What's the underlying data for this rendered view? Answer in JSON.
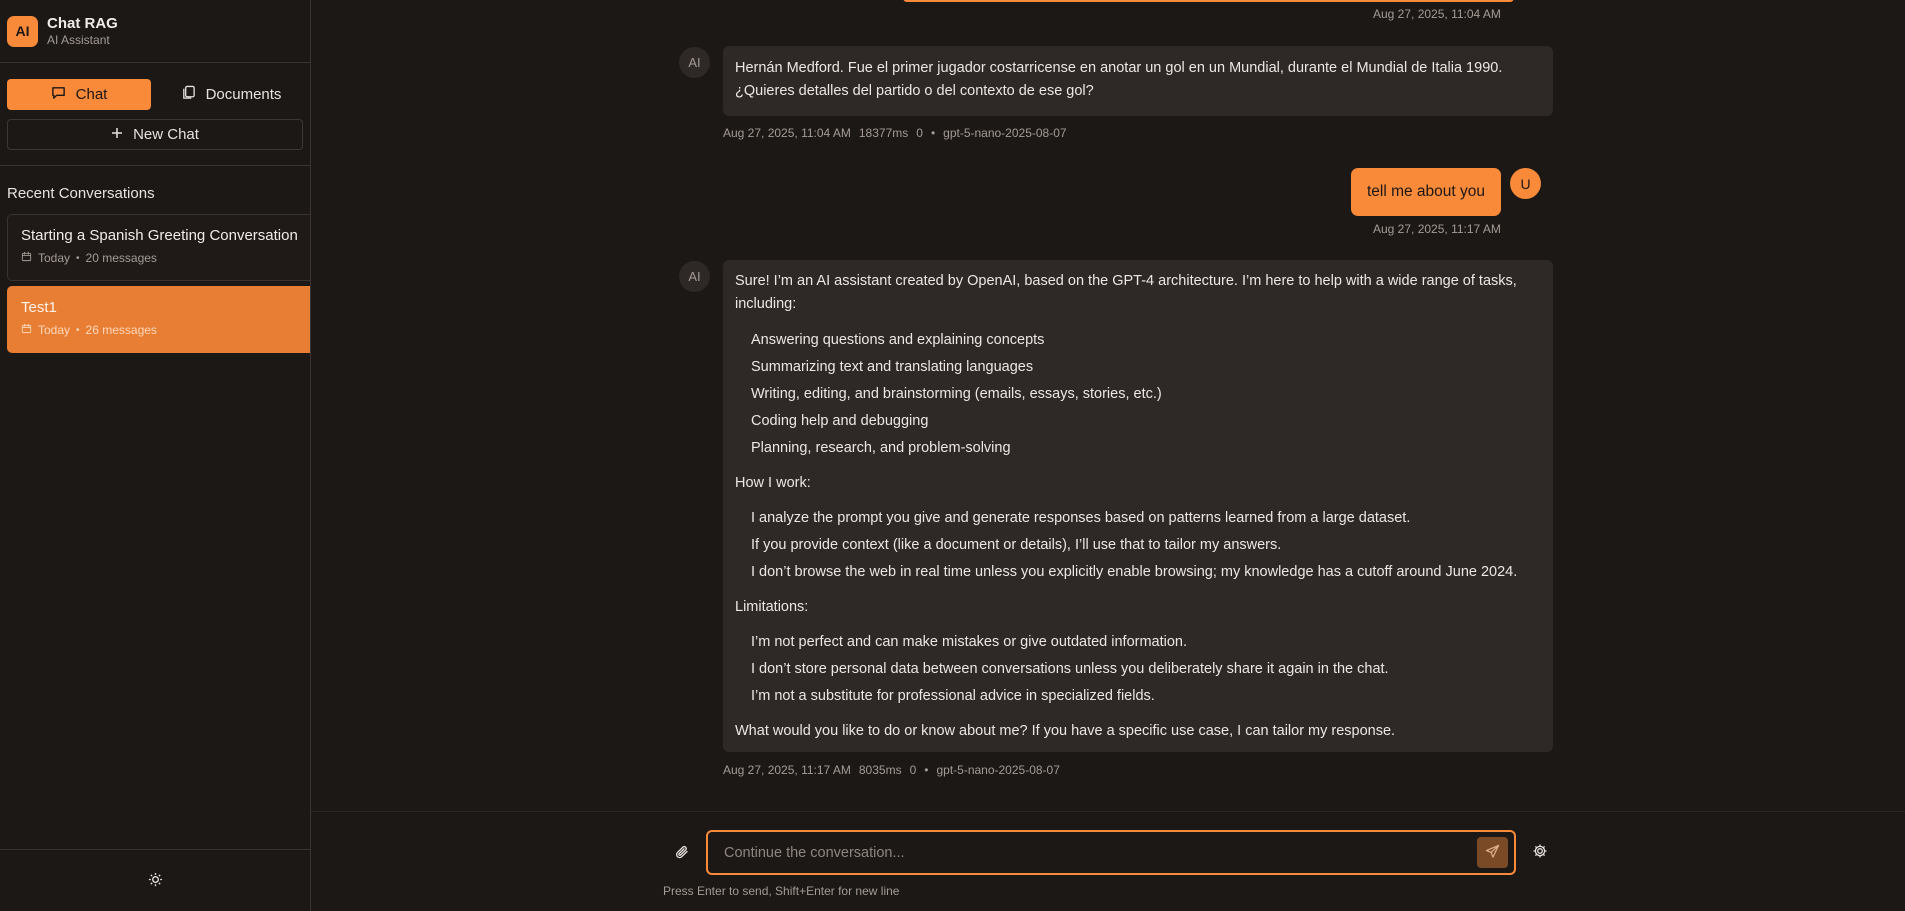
{
  "app": {
    "logo_text": "AI",
    "title": "Chat RAG",
    "subtitle": "AI Assistant"
  },
  "nav": {
    "chat_label": "Chat",
    "documents_label": "Documents",
    "new_chat_label": "New Chat"
  },
  "sidebar": {
    "recent_title": "Recent Conversations",
    "conversations": [
      {
        "title": "Starting a Spanish Greeting Conversation",
        "date": "Today",
        "count": "20 messages"
      },
      {
        "title": "Test1",
        "date": "Today",
        "count": "26 messages"
      }
    ]
  },
  "messages": {
    "top_time": "Aug 27, 2025, 11:04 AM",
    "ai1": {
      "avatar": "AI",
      "lines": [
        "Hernán Medford. Fue el primer jugador costarricense en anotar un gol en un Mundial, durante el Mundial de Italia 1990.",
        "¿Quieres detalles del partido o del contexto de ese gol?"
      ],
      "time": "Aug 27, 2025, 11:04 AM",
      "duration": "18377ms",
      "tokens": "0",
      "model": "gpt-5-nano-2025-08-07"
    },
    "user1": {
      "avatar": "U",
      "text": "tell me about you",
      "time": "Aug 27, 2025, 11:17 AM"
    },
    "ai2": {
      "avatar": "AI",
      "intro_1": "Sure! I’m an AI assistant created by OpenAI, based on the GPT-4 architecture. I’m here to help with a wide range of tasks,",
      "intro_2": "including:",
      "tasks": [
        "Answering questions and explaining concepts",
        "Summarizing text and translating languages",
        "Writing, editing, and brainstorming (emails, essays, stories, etc.)",
        "Coding help and debugging",
        "Planning, research, and problem-solving"
      ],
      "how_title": "How I work:",
      "how": [
        "I analyze the prompt you give and generate responses based on patterns learned from a large dataset.",
        "If you provide context (like a document or details), I’ll use that to tailor my answers.",
        "I don’t browse the web in real time unless you explicitly enable browsing; my knowledge has a cutoff around June 2024."
      ],
      "limits_title": "Limitations:",
      "limits": [
        "I’m not perfect and can make mistakes or give outdated information.",
        "I don’t store personal data between conversations unless you deliberately share it again in the chat.",
        "I’m not a substitute for professional advice in specialized fields."
      ],
      "closing": "What would you like to do or know about me? If you have a specific use case, I can tailor my response.",
      "time": "Aug 27, 2025, 11:17 AM",
      "duration": "8035ms",
      "tokens": "0",
      "model": "gpt-5-nano-2025-08-07"
    }
  },
  "composer": {
    "placeholder": "Continue the conversation...",
    "hint": "Press Enter to send, Shift+Enter for new line"
  },
  "colors": {
    "accent": "#f88a3a",
    "background": "#1c1816",
    "bubble": "#2e2826"
  }
}
